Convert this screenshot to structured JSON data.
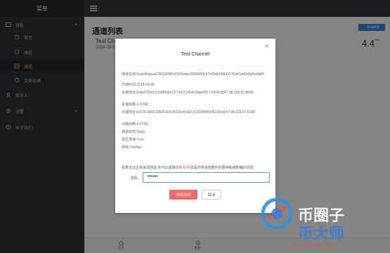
{
  "sidebar": {
    "title": "菜单",
    "items": [
      {
        "label": "钱包",
        "icon": "wallet-icon",
        "type": "top",
        "expanded": true
      },
      {
        "label": "首页",
        "icon": "circle-icon",
        "type": "sub"
      },
      {
        "label": "收款",
        "icon": "circle-icon",
        "type": "sub"
      },
      {
        "label": "通道",
        "icon": "list-icon",
        "type": "sub",
        "active": true
      },
      {
        "label": "交易记录",
        "icon": "circle-icon",
        "type": "sub"
      },
      {
        "label": "联系人",
        "icon": "user-icon",
        "type": "top"
      },
      {
        "label": "设置",
        "icon": "gear-icon",
        "type": "top",
        "expanded": false
      },
      {
        "label": "关于我们",
        "icon": "info-icon",
        "type": "top"
      }
    ]
  },
  "page": {
    "title": "通道列表",
    "add_button": "+ 添加通道",
    "card": {
      "name": "Test Cha",
      "date": "2018-09-0",
      "amount": "4.4",
      "unit": "TNC"
    }
  },
  "bottom_nav": [
    {
      "label": "首页",
      "icon": "home-icon"
    },
    {
      "label": "更多",
      "icon": "more-icon"
    }
  ],
  "modal": {
    "title": "Test Channel",
    "fields": [
      {
        "key": "通道名称:",
        "value": "0xde86aeea236264380d7939dae1f608459c97e56db08842176d41dd0d1b5e8b89"
      },
      {
        "key": "开通时间:",
        "value": "2018-09-00"
      },
      {
        "key": "本端地址:",
        "value": "0xAd735431c5d860eeCF71b7Ce84b39ab65F7c05D8@47.98.228.81:8089"
      },
      {
        "key": "本端余额:",
        "value": "4.4TNC"
      },
      {
        "key": "对端地址:",
        "value": "0xC3C966C28E8DE5c5022e40a62cF29586B60A22b0@47.98.228.81:8189"
      },
      {
        "key": "对端余额:",
        "value": "4.6TNC"
      },
      {
        "key": "通道状态:",
        "value": "Open"
      },
      {
        "key": "是否连接:",
        "value": "True"
      },
      {
        "key": "网络:",
        "value": "TestNet"
      }
    ],
    "warning_prefix": "如果无法正常关闭通道,你可以选择",
    "warning_link": "强制关闭",
    "warning_suffix": ",但是你将承担额外的费用和被制裁的风险",
    "password_label": "密码",
    "password_value": "••••••",
    "primary_button": "快速关闭",
    "cancel_button": "取消"
  },
  "watermark": {
    "line1": "币圈子",
    "line2": "币大师",
    "url": "www.120btc.com"
  },
  "colors": {
    "sidebar_bg": "#2e3137",
    "active": "#f2a93b",
    "primary": "#2f7fd6",
    "danger": "#ef6a6a"
  }
}
